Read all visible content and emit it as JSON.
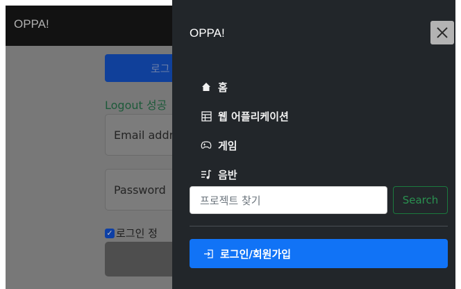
{
  "background_page": {
    "brand": "OPPA!",
    "login_button_label": "로그",
    "logout_text": "Logout 성공",
    "email_placeholder": "Email addr",
    "password_placeholder": "Password",
    "remember_label": "로그인 정",
    "remember_checked": true
  },
  "offcanvas": {
    "title": "OPPA!",
    "close_icon": "close-x-icon",
    "nav_items": [
      {
        "label": "홈",
        "icon": "home-icon"
      },
      {
        "label": "웹 어플리케이션",
        "icon": "table-icon"
      },
      {
        "label": "게임",
        "icon": "controller-icon"
      },
      {
        "label": "음반",
        "icon": "music-list-icon"
      }
    ],
    "search": {
      "placeholder": "프로젝트 찾기",
      "button_label": "Search"
    },
    "login_button_label": "로그인/회원가입",
    "login_icon": "box-arrow-in-icon"
  },
  "colors": {
    "offcanvas_bg": "#22262a",
    "primary": "#1173f6",
    "success": "#2a9150"
  }
}
